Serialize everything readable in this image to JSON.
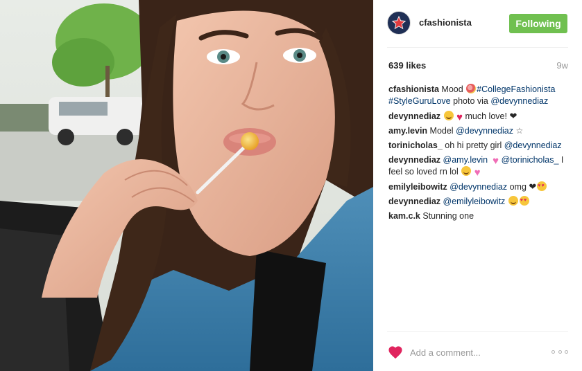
{
  "post": {
    "username": "cfashionista",
    "follow_label": "Following",
    "likes": "639 likes",
    "time": "9w"
  },
  "comments": [
    {
      "user": "cfashionista",
      "parts": [
        {
          "t": "text",
          "v": " Mood "
        },
        {
          "t": "emoji",
          "v": "lollipop"
        },
        {
          "t": "tag",
          "v": "#CollegeFashionista #StyleGuruLove"
        },
        {
          "t": "text",
          "v": " photo via "
        },
        {
          "t": "tag",
          "v": "@devynnediaz"
        }
      ]
    },
    {
      "user": "devynnediaz",
      "parts": [
        {
          "t": "text",
          "v": " "
        },
        {
          "t": "emoji",
          "v": "smile"
        },
        {
          "t": "emoji",
          "v": "red-heart"
        },
        {
          "t": "text",
          "v": "much love! "
        },
        {
          "t": "emoji",
          "v": "black-heart"
        }
      ]
    },
    {
      "user": "amy.levin",
      "parts": [
        {
          "t": "text",
          "v": " Model "
        },
        {
          "t": "tag",
          "v": "@devynnediaz"
        },
        {
          "t": "text",
          "v": " "
        },
        {
          "t": "emoji",
          "v": "star"
        }
      ]
    },
    {
      "user": "torinicholas_",
      "parts": [
        {
          "t": "text",
          "v": " oh hi pretty girl "
        },
        {
          "t": "tag",
          "v": "@devynnediaz"
        }
      ]
    },
    {
      "user": "devynnediaz",
      "parts": [
        {
          "t": "text",
          "v": " "
        },
        {
          "t": "tag",
          "v": "@amy.levin"
        },
        {
          "t": "text",
          "v": " "
        },
        {
          "t": "emoji",
          "v": "pink-heart"
        },
        {
          "t": "tag",
          "v": "@torinicholas_"
        },
        {
          "t": "text",
          "v": " I feel so loved rn lol "
        },
        {
          "t": "emoji",
          "v": "smile"
        },
        {
          "t": "emoji",
          "v": "pink-heart"
        }
      ]
    },
    {
      "user": "emilyleibowitz",
      "parts": [
        {
          "t": "text",
          "v": " "
        },
        {
          "t": "tag",
          "v": "@devynnediaz"
        },
        {
          "t": "text",
          "v": " omg "
        },
        {
          "t": "emoji",
          "v": "black-heart"
        },
        {
          "t": "emoji",
          "v": "heart-eyes"
        }
      ]
    },
    {
      "user": "devynnediaz",
      "parts": [
        {
          "t": "text",
          "v": " "
        },
        {
          "t": "tag",
          "v": "@emilyleibowitz"
        },
        {
          "t": "text",
          "v": " "
        },
        {
          "t": "emoji",
          "v": "smile"
        },
        {
          "t": "emoji",
          "v": "heart-eyes"
        }
      ]
    },
    {
      "user": "kam.c.k",
      "parts": [
        {
          "t": "text",
          "v": " Stunning one"
        }
      ]
    }
  ],
  "footer": {
    "comment_placeholder": "Add a comment..."
  },
  "colors": {
    "follow_bg": "#70c050",
    "tag": "#003569",
    "like_heart": "#e0245e",
    "muted": "#999999"
  },
  "icons": {
    "avatar": "star-logo-icon",
    "like": "heart-icon",
    "more": "more-options-icon"
  }
}
